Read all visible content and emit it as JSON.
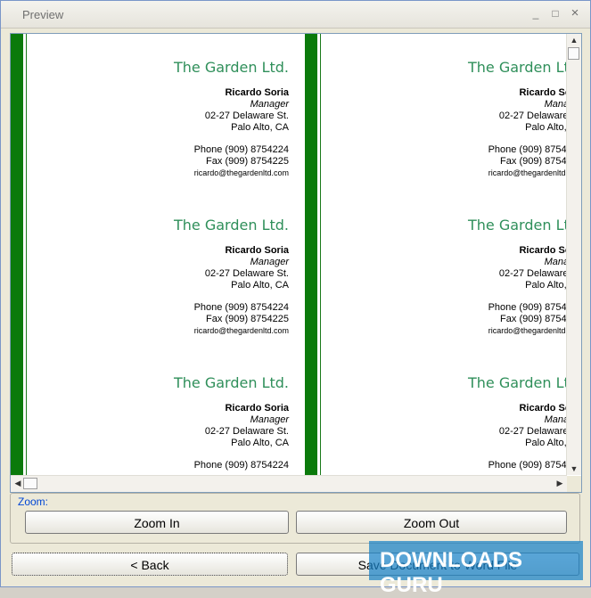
{
  "window": {
    "title": "Preview",
    "minimize_glyph": "_",
    "maximize_glyph": "□",
    "close_glyph": "×"
  },
  "card": {
    "company": "The Garden Ltd.",
    "name": "Ricardo Soria",
    "role": "Manager",
    "street": "02-27 Delaware St.",
    "city": "Palo Alto, CA",
    "phone": "Phone (909) 8754224",
    "fax": "Fax (909) 8754225",
    "email": "ricardo@thegardenltd.com"
  },
  "colors": {
    "stripe": "#0b7a0b",
    "company_text": "#2f8f5a",
    "legend_text": "#0046d5"
  },
  "zoom": {
    "legend": "Zoom:",
    "zoom_in": "Zoom In",
    "zoom_out": "Zoom Out"
  },
  "footer": {
    "back": "< Back",
    "save": "Save Document to Word File"
  },
  "watermark": {
    "text": "DOWNLOADS GURU"
  }
}
